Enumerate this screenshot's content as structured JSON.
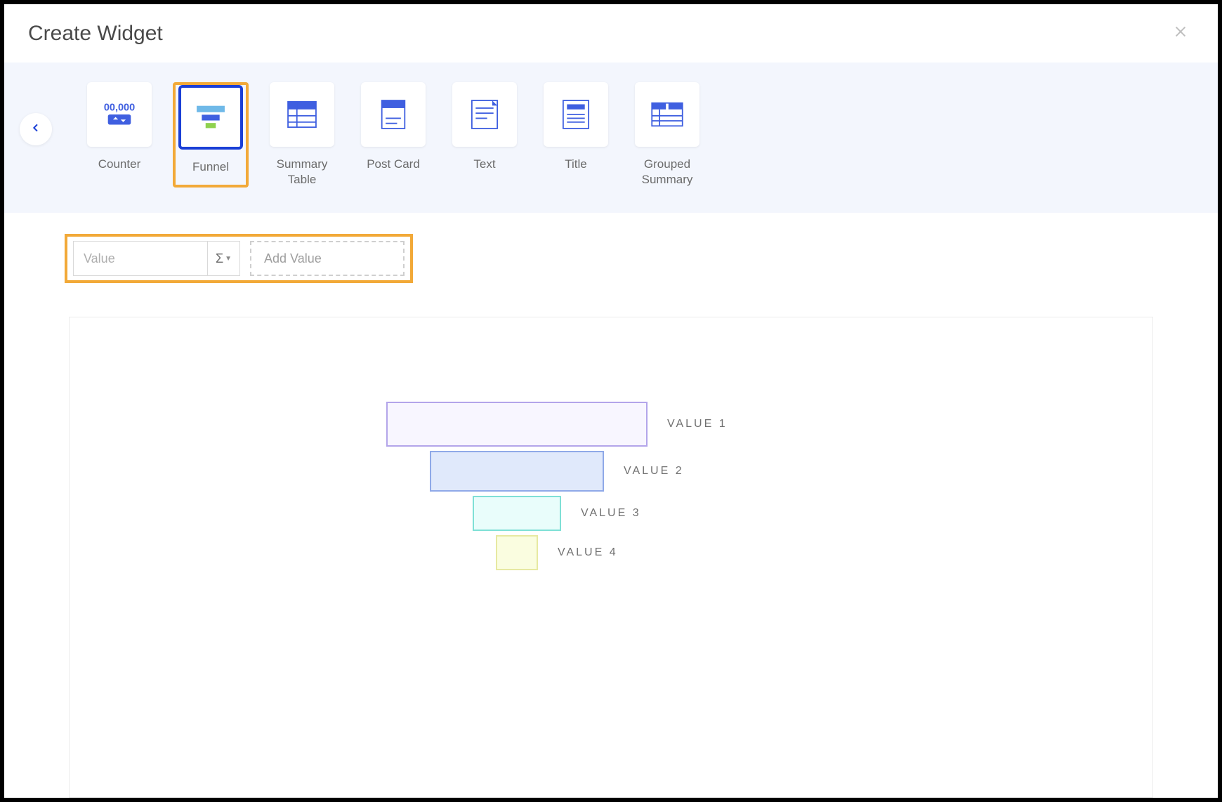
{
  "modal": {
    "title": "Create Widget"
  },
  "widgets": [
    {
      "id": "counter",
      "label": "Counter",
      "selected": false
    },
    {
      "id": "funnel",
      "label": "Funnel",
      "selected": true,
      "highlighted": true
    },
    {
      "id": "summary-table",
      "label": "Summary Table",
      "selected": false
    },
    {
      "id": "post-card",
      "label": "Post Card",
      "selected": false
    },
    {
      "id": "text",
      "label": "Text",
      "selected": false
    },
    {
      "id": "title",
      "label": "Title",
      "selected": false
    },
    {
      "id": "grouped-summary",
      "label": "Grouped Summary",
      "selected": false
    }
  ],
  "config": {
    "value_placeholder": "Value",
    "sigma_symbol": "Σ",
    "add_value_label": "Add Value"
  },
  "funnel_preview": {
    "rows": [
      {
        "label": "VALUE 1"
      },
      {
        "label": "VALUE 2"
      },
      {
        "label": "VALUE 3"
      },
      {
        "label": "VALUE 4"
      }
    ]
  },
  "colors": {
    "highlight_border": "#f2a938",
    "selected_border": "#1a3fd6",
    "panel_bg": "#f3f6fd"
  }
}
